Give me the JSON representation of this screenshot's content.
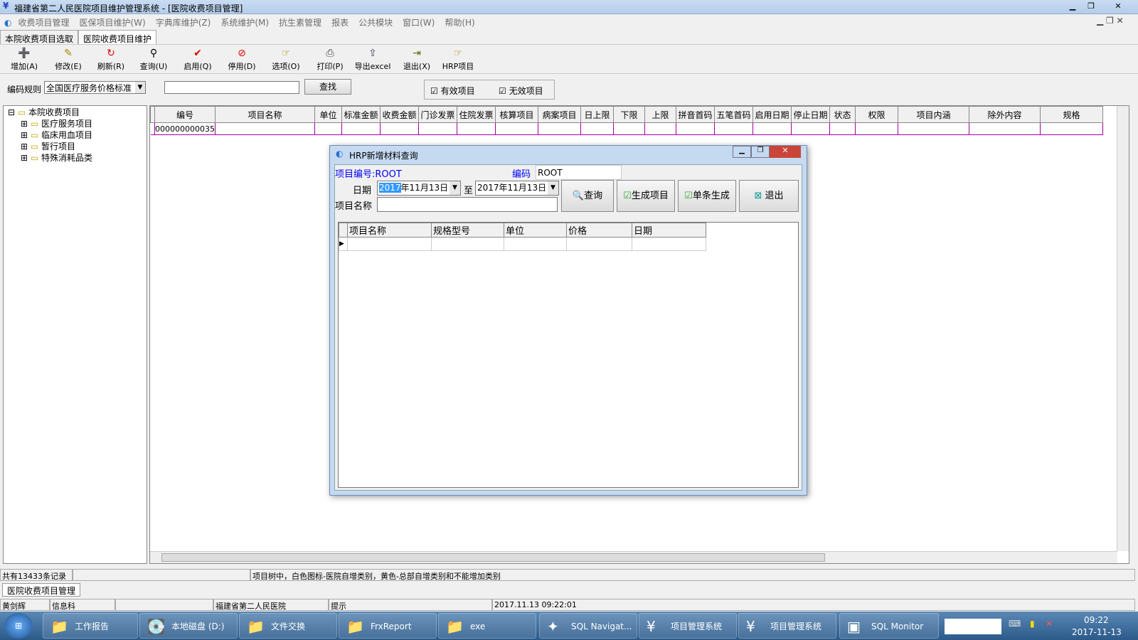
{
  "window": {
    "title": "福建省第二人民医院项目维护管理系统 - [医院收费项目管理]"
  },
  "menu": [
    "收费项目管理",
    "医保项目维护(W)",
    "字典库维护(Z)",
    "系统维护(M)",
    "抗生素管理",
    "报表",
    "公共模块",
    "窗口(W)",
    "帮助(H)"
  ],
  "tabs": [
    "本院收费项目选取",
    "医院收费项目维护"
  ],
  "toolbar": [
    {
      "label": "增加(A)",
      "icon": "add-icon",
      "glyph": "➕",
      "color": "#d00"
    },
    {
      "label": "修改(E)",
      "icon": "edit-icon",
      "glyph": "✎",
      "color": "#a80"
    },
    {
      "label": "刷新(R)",
      "icon": "refresh-icon",
      "glyph": "↻",
      "color": "#d00"
    },
    {
      "label": "查询(U)",
      "icon": "binoculars-icon",
      "glyph": "⚲",
      "color": "#000"
    },
    {
      "label": "启用(Q)",
      "icon": "check-icon",
      "glyph": "✔",
      "color": "#d00"
    },
    {
      "label": "停用(D)",
      "icon": "disable-icon",
      "glyph": "⊘",
      "color": "#d00"
    },
    {
      "label": "选项(O)",
      "icon": "options-icon",
      "glyph": "☞",
      "color": "#a80"
    },
    {
      "label": "打印(P)",
      "icon": "print-icon",
      "glyph": "⎙",
      "color": "#444"
    },
    {
      "label": "导出excel",
      "icon": "export-icon",
      "glyph": "⇪",
      "color": "#446"
    },
    {
      "label": "退出(X)",
      "icon": "exit-icon",
      "glyph": "⇥",
      "color": "#660"
    },
    {
      "label": "HRP项目",
      "icon": "hrp-icon",
      "glyph": "☞",
      "color": "#a80"
    }
  ],
  "filter": {
    "rule_label": "编码规则",
    "rule_value": "全国医疗服务价格标准",
    "search_value": "",
    "search_button": "查找",
    "valid_label": "有效项目",
    "invalid_label": "无效项目",
    "valid_checked": true,
    "invalid_checked": true
  },
  "tree": {
    "root": "本院收费项目",
    "children": [
      "医疗服务项目",
      "临床用血项目",
      "暂行项目",
      "特殊消耗品类"
    ]
  },
  "grid": {
    "columns": [
      "编号",
      "项目名称",
      "单位",
      "标准金额",
      "收费金额",
      "门诊发票",
      "住院发票",
      "核算项目",
      "病案项目",
      "日上限",
      "下限",
      "上限",
      "拼音首码",
      "五笔首码",
      "启用日期",
      "停止日期",
      "状态",
      "权限",
      "项目内涵",
      "除外内容",
      "规格"
    ],
    "rows": [
      [
        "000000000035",
        "",
        "",
        "",
        "",
        "",
        "",
        "",
        "",
        "",
        "",
        "",
        "",
        "",
        "",
        "",
        "",
        "",
        "",
        "",
        ""
      ]
    ]
  },
  "dialog": {
    "title": "HRP新增材料查询",
    "item_code_label": "项目编号:ROOT",
    "code_label": "编码",
    "code_value": "ROOT",
    "date_label": "日期",
    "date_from": "2017年11月13日",
    "date_from_selected": "2017",
    "date_from_rest": "年11月13日",
    "to_label": "至",
    "date_to": "2017年11月13日",
    "name_label": "项目名称",
    "name_value": "",
    "query_button": "查询",
    "generate_button": "生成项目",
    "single_button": "单条生成",
    "exit_button": "退出",
    "columns": [
      "项目名称",
      "规格型号",
      "单位",
      "价格",
      "日期"
    ]
  },
  "status": {
    "records": "共有13433条记录",
    "hint": "项目树中，白色图标-医院自增类别，黄色-总部自增类别和不能增加类别",
    "window_tab": "医院收费项目管理",
    "user": "黄剑辉",
    "dept": "信息科",
    "hospital": "福建省第二人民医院",
    "prompt": "提示",
    "datetime": "2017.11.13   09:22:01"
  },
  "taskbar": {
    "items": [
      {
        "label": "工作报告",
        "glyph": "📁"
      },
      {
        "label": "本地磁盘 (D:)",
        "glyph": "💽"
      },
      {
        "label": "文件交换",
        "glyph": "📁"
      },
      {
        "label": "FrxReport",
        "glyph": "📁"
      },
      {
        "label": "exe",
        "glyph": "📁"
      },
      {
        "label": "SQL Navigat...",
        "glyph": "✦"
      },
      {
        "label": "项目管理系统",
        "glyph": "¥"
      },
      {
        "label": "项目管理系统",
        "glyph": "¥"
      },
      {
        "label": "SQL Monitor",
        "glyph": "▣"
      }
    ],
    "time": "09:22",
    "date": "2017-11-13"
  }
}
